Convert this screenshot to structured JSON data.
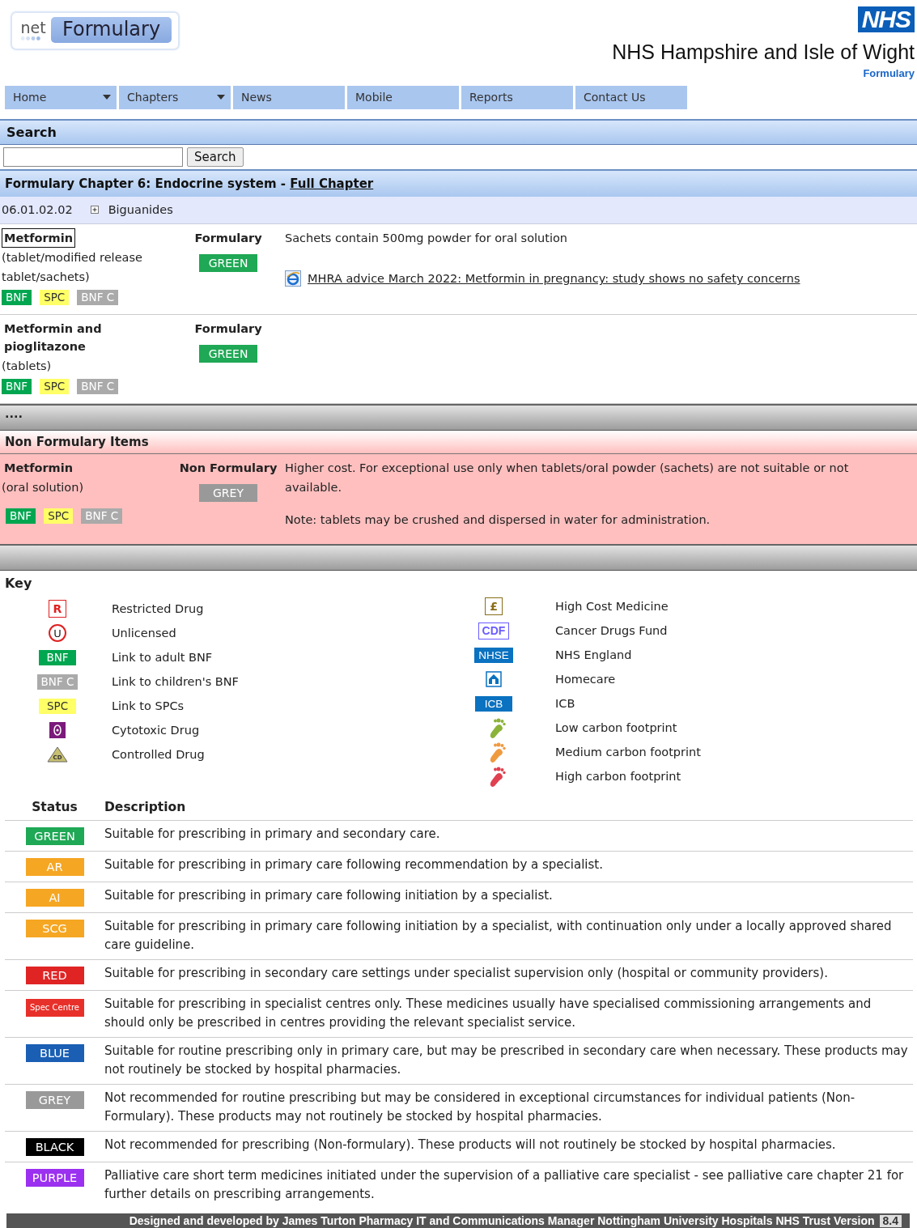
{
  "logo": {
    "prefix": "net",
    "name": "Formulary"
  },
  "org": {
    "badge": "NHS",
    "title": "NHS Hampshire and Isle of Wight",
    "subtitle": "Formulary"
  },
  "nav": [
    {
      "label": "Home",
      "dropdown": true
    },
    {
      "label": "Chapters",
      "dropdown": true
    },
    {
      "label": "News",
      "dropdown": false
    },
    {
      "label": "Mobile",
      "dropdown": false
    },
    {
      "label": "Reports",
      "dropdown": false
    },
    {
      "label": "Contact Us",
      "dropdown": false
    }
  ],
  "search": {
    "title": "Search",
    "button": "Search"
  },
  "chapter_bar": {
    "text": "Formulary Chapter 6: Endocrine system - ",
    "link": "Full Chapter"
  },
  "subsection": {
    "code": "06.01.02.02",
    "title": "Biguanides"
  },
  "formulary_items": [
    {
      "name": "Metformin",
      "outlined": true,
      "form": "(tablet/modified release tablet/sachets)",
      "status_heading": "Formulary",
      "status": {
        "label": "GREEN",
        "color": "#1fa855"
      },
      "notes": [
        "Sachets contain 500mg powder for oral solution"
      ],
      "link": "MHRA advice March 2022: Metformin in pregnancy: study shows no safety concerns",
      "refs": [
        {
          "label": "BNF",
          "color": "#00a650"
        },
        {
          "label": "SPC",
          "color": "#ffff66"
        },
        {
          "label": "BNF C",
          "color": "#aaaaaa"
        }
      ]
    },
    {
      "name": "Metformin and pioglitazone",
      "outlined": false,
      "form": "(tablets)",
      "status_heading": "Formulary",
      "status": {
        "label": "GREEN",
        "color": "#1fa855"
      },
      "refs": [
        {
          "label": "BNF",
          "color": "#00a650"
        },
        {
          "label": "SPC",
          "color": "#ffff66"
        },
        {
          "label": "BNF C",
          "color": "#aaaaaa"
        }
      ]
    }
  ],
  "separator": "....",
  "non_formulary": {
    "title": "Non Formulary Items",
    "items": [
      {
        "name": "Metformin",
        "outlined": false,
        "form": "(oral solution)",
        "status_heading": "Non Formulary",
        "status": {
          "label": "GREY",
          "color": "#999999"
        },
        "notes": [
          "Higher cost. For exceptional use only when tablets/oral powder (sachets) are not suitable or not available.",
          "Note: tablets may be crushed and dispersed in water for administration."
        ],
        "refs": [
          {
            "label": "BNF",
            "color": "#00a650"
          },
          {
            "label": "SPC",
            "color": "#ffff66"
          },
          {
            "label": "BNF C",
            "color": "#aaaaaa"
          }
        ]
      }
    ]
  },
  "key": {
    "title": "Key",
    "left": [
      {
        "kind": "square-letter",
        "symbol": "R",
        "color": "#e02020",
        "label": "Restricted Drug"
      },
      {
        "kind": "circle-letter",
        "symbol": "U",
        "color": "#e02020",
        "label": "Unlicensed"
      },
      {
        "kind": "badge",
        "symbol": "BNF",
        "color": "#00a650",
        "label": "Link to adult BNF"
      },
      {
        "kind": "badge",
        "symbol": "BNF C",
        "color": "#aaaaaa",
        "label": "Link to children's BNF"
      },
      {
        "kind": "badge",
        "symbol": "SPC",
        "color": "#ffff66",
        "label": "Link to SPCs"
      },
      {
        "kind": "cytotoxic",
        "color": "#7b1a7b",
        "label": "Cytotoxic Drug"
      },
      {
        "kind": "triangle",
        "symbol": "CD",
        "color": "#c8c070",
        "label": "Controlled Drug"
      }
    ],
    "right": [
      {
        "kind": "square-letter",
        "symbol": "£",
        "color": "#8a6d1a",
        "label": "High Cost Medicine"
      },
      {
        "kind": "outline-badge",
        "symbol": "CDF",
        "color": "#6a5cff",
        "label": "Cancer Drugs Fund"
      },
      {
        "kind": "badge",
        "symbol": "NHSE",
        "color": "#0a72c0",
        "label": "NHS England"
      },
      {
        "kind": "home",
        "color": "#0a72c0",
        "label": "Homecare"
      },
      {
        "kind": "badge",
        "symbol": "ICB",
        "color": "#0a72c0",
        "label": "ICB"
      },
      {
        "kind": "footprint",
        "color": "#8bb33a",
        "label": "Low carbon footprint"
      },
      {
        "kind": "footprint",
        "color": "#f09a40",
        "label": "Medium carbon footprint"
      },
      {
        "kind": "footprint",
        "color": "#e04050",
        "label": "High carbon footprint"
      }
    ]
  },
  "status_table": {
    "columns": [
      "Status",
      "Description"
    ],
    "rows": [
      {
        "status": "GREEN",
        "color": "#1fa855",
        "description": "Suitable for prescribing in primary and secondary care."
      },
      {
        "status": "AR",
        "color": "#f5a623",
        "description": "Suitable for prescribing in primary care following recommendation by a specialist."
      },
      {
        "status": "AI",
        "color": "#f5a623",
        "description": "Suitable for prescribing in primary care following initiation by a specialist."
      },
      {
        "status": "SCG",
        "color": "#f5a623",
        "description": "Suitable for prescribing in primary care following initiation by a specialist, with continuation only under a locally approved shared care guideline."
      },
      {
        "status": "RED",
        "color": "#e02424",
        "description": "Suitable for prescribing in secondary care settings under specialist supervision only (hospital or community providers)."
      },
      {
        "status": "Spec Centre",
        "color": "#e8302a",
        "description": "Suitable for prescribing in specialist centres only. These medicines usually have specialised commissioning arrangements and should only be prescribed in centres providing the relevant specialist service."
      },
      {
        "status": "BLUE",
        "color": "#1a5fb4",
        "description": "Suitable for routine prescribing only in primary care, but may be prescribed in secondary care when necessary. These products may not routinely be stocked by hospital pharmacies."
      },
      {
        "status": "GREY",
        "color": "#999999",
        "description": "Not recommended for routine prescribing but may be considered in exceptional circumstances for individual patients (Non-Formulary). These products may not routinely be stocked by hospital pharmacies."
      },
      {
        "status": "BLACK",
        "color": "#000000",
        "description": "Not recommended for prescribing (Non-formulary). These products will not routinely be stocked by hospital pharmacies."
      },
      {
        "status": "PURPLE",
        "color": "#9b30f0",
        "description": "Palliative care short term medicines initiated under the supervision of a palliative care specialist - see palliative care chapter 21 for further details on prescribing arrangements."
      }
    ]
  },
  "footer": {
    "text": "Designed and developed by James Turton Pharmacy IT and Communications Manager Nottingham University Hospitals NHS Trust  Version",
    "version": "8.4"
  }
}
